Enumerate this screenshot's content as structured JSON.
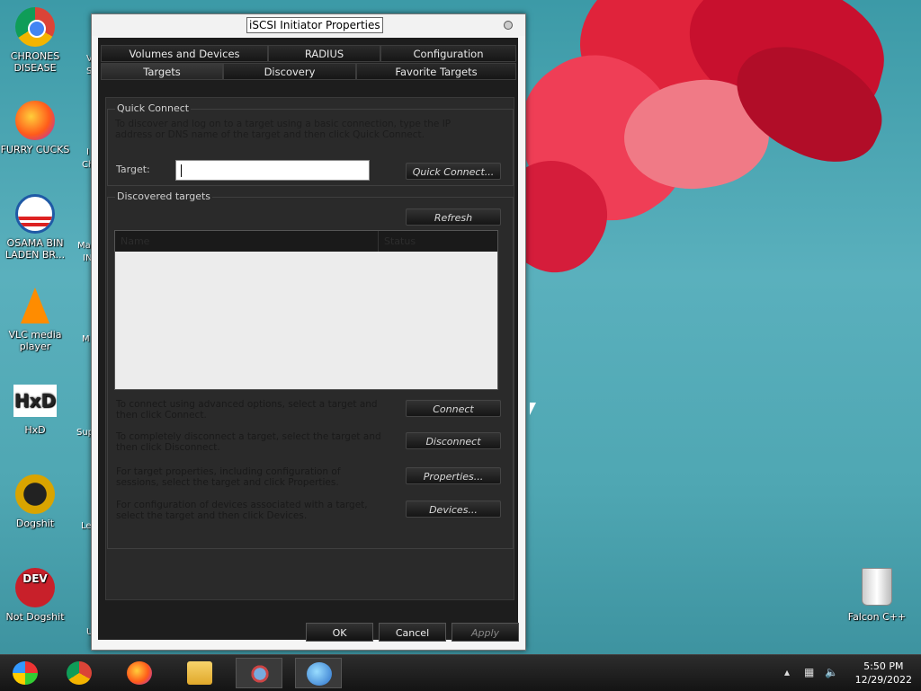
{
  "desktop": {
    "icons": [
      {
        "label": "CHRONES DISEASE",
        "icon": "chrome-icon",
        "color": "#2a73d9"
      },
      {
        "label": "FURRY CUCKS",
        "icon": "firefox-icon",
        "color": "#ff7a1a"
      },
      {
        "label": "OSAMA BIN LADEN BR...",
        "icon": "obama-logo-icon",
        "color": "#1f5aa6"
      },
      {
        "label": "VLC media player",
        "icon": "vlc-cone-icon",
        "color": "#ff8c00"
      },
      {
        "label": "HxD",
        "icon": "hxd-icon",
        "color": "#ffffff"
      },
      {
        "label": "Dogshit",
        "icon": "dogshit-icon",
        "color": "#d9a400"
      },
      {
        "label": "Not Dogshit",
        "icon": "dev-cpp-icon",
        "color": "#c8202a"
      }
    ],
    "partial_labels": [
      "V",
      "S",
      "I",
      "Ch",
      "Ma",
      "IN",
      "M",
      "Sup",
      "Le",
      "U"
    ],
    "recycle_bin": {
      "label": "Falcon C++",
      "icon": "recycle-bin-icon"
    }
  },
  "window": {
    "title": "iSCSI Initiator Properties",
    "tabs_top": [
      "Volumes and Devices",
      "RADIUS",
      "Configuration"
    ],
    "tabs_bottom": [
      "Targets",
      "Discovery",
      "Favorite Targets"
    ],
    "active_tab": "Targets",
    "quick_connect": {
      "group_label": "Quick Connect",
      "description": "To discover and log on to a target using a basic connection, type the IP address or DNS name of the target and then click Quick Connect.",
      "target_label": "Target:",
      "target_value": "",
      "button": "Quick Connect..."
    },
    "discovered": {
      "group_label": "Discovered targets",
      "refresh_button": "Refresh",
      "columns": [
        "Name",
        "Status"
      ]
    },
    "actions": [
      {
        "text": "To connect using advanced options, select a target and then click Connect.",
        "button": "Connect"
      },
      {
        "text": "To completely disconnect a target, select the target and then click Disconnect.",
        "button": "Disconnect"
      },
      {
        "text": "For target properties, including configuration of sessions, select the target and click Properties.",
        "button": "Properties..."
      },
      {
        "text": "For configuration of devices associated with a target, select the target and then click Devices.",
        "button": "Devices..."
      }
    ],
    "footer": {
      "ok": "OK",
      "cancel": "Cancel",
      "apply": "Apply"
    }
  },
  "taskbar": {
    "items": [
      "start-orb-icon",
      "chrome-icon",
      "firefox-icon",
      "file-explorer-icon",
      "network-users-icon",
      "iscsi-globe-icon"
    ],
    "clock_time": "5:50 PM",
    "clock_date": "12/29/2022"
  }
}
